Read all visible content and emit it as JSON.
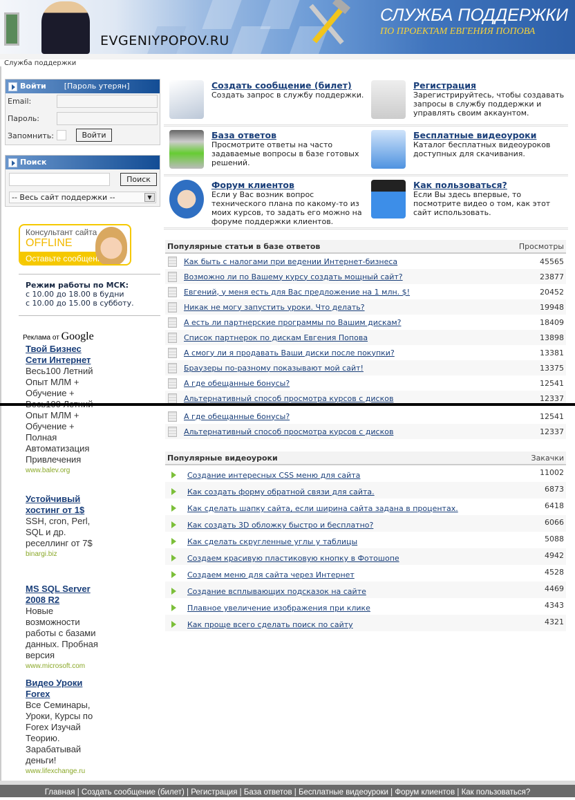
{
  "header": {
    "site_name": "EVGENIYPOPOV.RU",
    "title": "СЛУЖБА ПОДДЕРЖКИ",
    "subtitle": "ПО ПРОЕКТАМ ЕВГЕНИЯ ПОПОВА"
  },
  "breadcrumb": "Служба поддержки",
  "login": {
    "title": "Войти",
    "lost_password": "[Пароль утерян]",
    "email_label": "Email:",
    "password_label": "Пароль:",
    "remember_label": "Запомнить:",
    "submit": "Войти"
  },
  "search": {
    "title": "Поиск",
    "button": "Поиск",
    "scope": "-- Весь сайт поддержки --"
  },
  "consultant": {
    "line1": "Консультант сайта",
    "status": "OFFLINE",
    "action": "Оставьте сообщение"
  },
  "hours": {
    "title": "Режим работы по МСК:",
    "weekdays": "с 10.00 до 18.00 в будни",
    "saturday": "с 10.00 до 15.00 в субботу."
  },
  "ads": {
    "label": "Реклама от",
    "brand": "Google",
    "items": [
      {
        "title": "Твой Бизнес Сети Интернет",
        "lines": [
          "Весь100 Летний",
          "Опыт МЛМ +",
          "Обучение +",
          "Весь100 Летний",
          "Опыт МЛМ +",
          "Обучение +",
          "Полная",
          "Автоматизация",
          "Привлечения"
        ],
        "url": "www.balev.org"
      },
      {
        "title": "Устойчивый хостинг от 1$",
        "lines": [
          "SSH, cron, Perl,",
          "SQL и др.",
          "реселлинг от 7$"
        ],
        "url": "binargi.biz"
      },
      {
        "title": "MS SQL Server 2008 R2",
        "lines": [
          "Новые",
          "возможности",
          "работы с базами",
          "данных. Пробная",
          "версия"
        ],
        "url": "www.microsoft.com"
      },
      {
        "title": "Видео Уроки Forex",
        "lines": [
          "Все Семинары,",
          "Уроки, Курсы по",
          "Forex Изучай",
          "Теорию.",
          "Зарабатывай",
          "деньги!"
        ],
        "url": "www.lifexchange.ru"
      }
    ]
  },
  "features": [
    {
      "icon": "notepad-icon",
      "title": "Создать сообщение (билет)",
      "desc": "Создать запрос в службу поддержки."
    },
    {
      "icon": "id-card-icon",
      "title": "Регистрация",
      "desc": "Зарегистрируйтесь, чтобы создавать запросы в службу поддержки и управлять своим аккаунтом."
    },
    {
      "icon": "briefcase-icon",
      "title": "База ответов",
      "desc": "Просмотрите ответы на часто задаваемые вопросы в базе готовых решений."
    },
    {
      "icon": "download-arrow-icon",
      "title": "Бесплатные видеоуроки",
      "desc": "Каталог бесплатных видеоуроков доступных для скачивания."
    },
    {
      "icon": "users-icon",
      "title": "Форум клиентов",
      "desc": "Если у Вас возник вопрос технического плана по какому-то из моих курсов, то задать его можно на форуме поддержки клиентов."
    },
    {
      "icon": "clapperboard-icon",
      "title": "Как пользоваться?",
      "desc": "Если Вы здесь впервые, то посмотрите видео о том, как этот сайт использовать."
    }
  ],
  "articles": {
    "title": "Популярные статьи в базе ответов",
    "column": "Просмотры",
    "rows": [
      {
        "title": "Как быть с налогами при ведении Интернет-бизнеса",
        "views": "45565"
      },
      {
        "title": "Возможно ли по Вашему курсу создать мощный сайт?",
        "views": "23877"
      },
      {
        "title": "Евгений, у меня есть для Вас предложение на 1 млн. $!",
        "views": "20452"
      },
      {
        "title": "Никак не могу запустить уроки. Что делать?",
        "views": "19948"
      },
      {
        "title": "А есть ли партнерские программы по Вашим дискам?",
        "views": "18409"
      },
      {
        "title": "Список партнерок по дискам Евгения Попова",
        "views": "13898"
      },
      {
        "title": "А смогу ли я продавать Ваши диски после покупки?",
        "views": "13381"
      },
      {
        "title": "Браузеры по-разному показывают мой сайт!",
        "views": "13375"
      },
      {
        "title": "А где обещанные бонусы?",
        "views": "12541"
      },
      {
        "title": "Альтернативный способ просмотра курсов с дисков",
        "views": "12337"
      },
      {
        "title": "А где обещанные бонусы?",
        "views": "12541"
      },
      {
        "title": "Альтернативный способ просмотра курсов с дисков",
        "views": "12337"
      }
    ]
  },
  "videos": {
    "title": "Популярные видеоуроки",
    "column": "Закачки",
    "rows": [
      {
        "title": "Создание интересных CSS меню для сайта",
        "downloads": "11002"
      },
      {
        "title": "Как создать форму обратной связи для сайта.",
        "downloads": "6873"
      },
      {
        "title": "Как сделать шапку сайта, если ширина сайта задана в процентах.",
        "downloads": "6418"
      },
      {
        "title": "Как создать 3D обложку быстро и бесплатно?",
        "downloads": "6066"
      },
      {
        "title": "Как сделать скругленные углы у таблицы",
        "downloads": "5088"
      },
      {
        "title": "Создаем красивую пластиковую кнопку в Фотошопе",
        "downloads": "4942"
      },
      {
        "title": "Создаем меню для сайта через Интернет",
        "downloads": "4528"
      },
      {
        "title": "Создание всплывающих подсказок на сайте",
        "downloads": "4469"
      },
      {
        "title": "Плавное увеличение изображения при клике",
        "downloads": "4343"
      },
      {
        "title": "Как проще всего сделать поиск по сайту",
        "downloads": "4321"
      }
    ]
  },
  "footer": [
    "Главная",
    "Создать сообщение (билет)",
    "Регистрация",
    "База ответов",
    "Бесплатные видеоуроки",
    "Форум клиентов",
    "Как пользоваться?"
  ]
}
